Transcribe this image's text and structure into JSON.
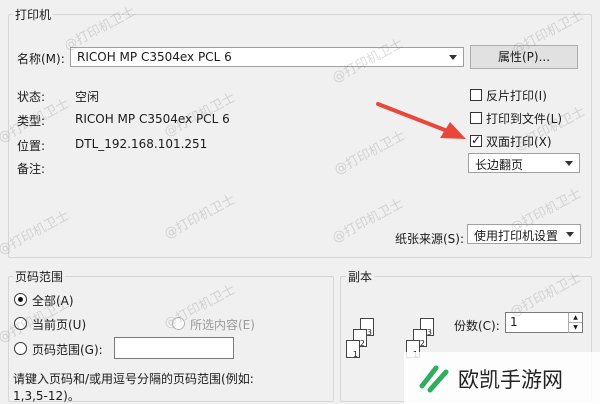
{
  "printer_group": {
    "title": "打印机",
    "name_label": "名称(M):",
    "name_value": "RICOH MP C3504ex PCL 6",
    "properties_button": "属性(P)...",
    "status_label": "状态:",
    "status_value": "空闲",
    "type_label": "类型:",
    "type_value": "RICOH MP C3504ex PCL 6",
    "location_label": "位置:",
    "location_value": "DTL_192.168.101.251",
    "comment_label": "备注:",
    "reverse_print": "反片打印(I)",
    "print_to_file": "打印到文件(L)",
    "duplex": "双面打印(X)",
    "duplex_mode": "长边翻页",
    "paper_source_label": "纸张来源(S):",
    "paper_source_value": "使用打印机设置"
  },
  "range_group": {
    "title": "页码范围",
    "all": "全部(A)",
    "current": "当前页(U)",
    "selection": "所选内容(E)",
    "pages": "页码范围(G):",
    "hint_line1": "请键入页码和/或用逗号分隔的页码范围(例如:",
    "hint_line2": "1,3,5-12)。"
  },
  "copies_group": {
    "title": "副本",
    "count_label": "份数(C):",
    "count_value": "1"
  },
  "watermark": {
    "text": "@打印机卫士"
  },
  "brand": {
    "text": "欧凯手游网"
  },
  "colors": {
    "arrow": "#e8473a",
    "brand_green": "#2fae5f"
  }
}
